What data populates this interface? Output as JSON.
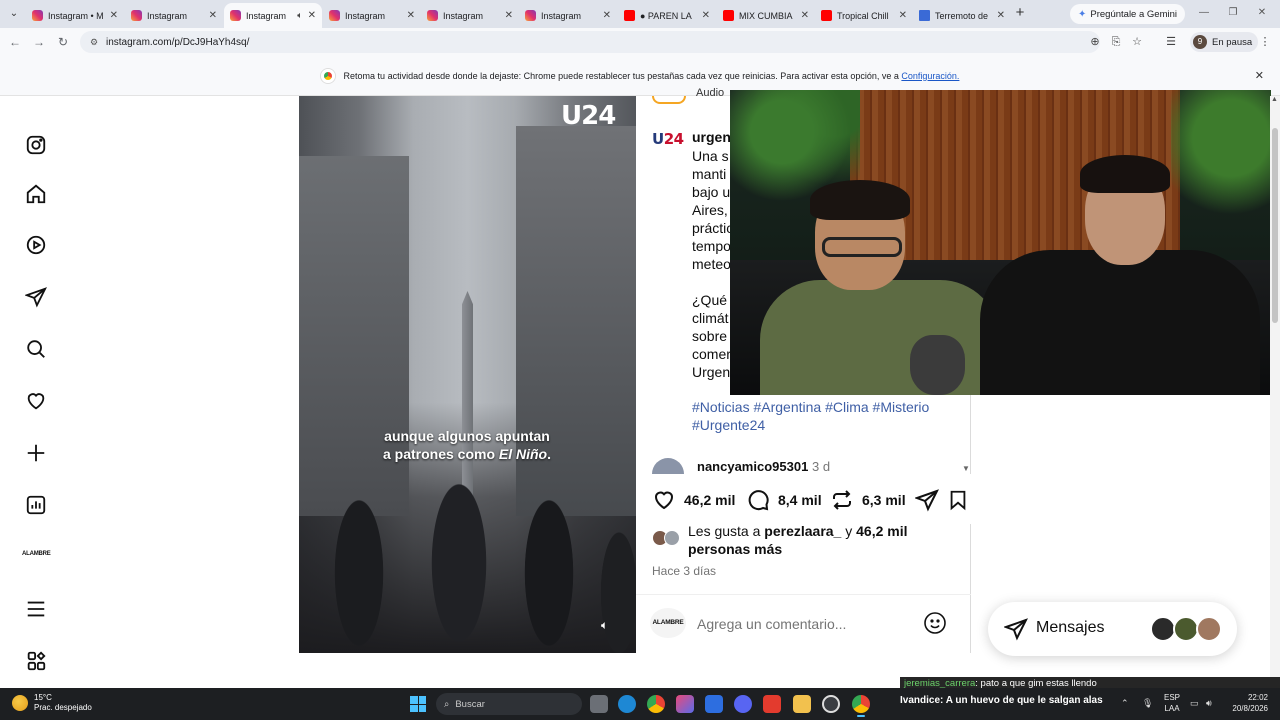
{
  "browser": {
    "tabs": [
      {
        "title": "Instagram • M",
        "favicon": "instagram-icon",
        "active": false
      },
      {
        "title": "Instagram",
        "favicon": "instagram-icon",
        "active": false
      },
      {
        "title": "Instagram",
        "favicon": "instagram-icon",
        "active": true,
        "sound": true
      },
      {
        "title": "Instagram",
        "favicon": "instagram-icon",
        "active": false
      },
      {
        "title": "Instagram",
        "favicon": "instagram-icon",
        "active": false
      },
      {
        "title": "Instagram",
        "favicon": "instagram-icon",
        "active": false
      },
      {
        "title": "● PAREN LA",
        "favicon": "youtube-icon",
        "active": false
      },
      {
        "title": "MIX CUMBIA",
        "favicon": "youtube-icon",
        "active": false
      },
      {
        "title": "Tropical Chill",
        "favicon": "youtube-icon",
        "active": false
      },
      {
        "title": "Terremoto de",
        "favicon": "web-icon",
        "active": false
      }
    ],
    "gemini_label": "Pregúntale a Gemini",
    "url": "instagram.com/p/DcJ9HaYh4sq/",
    "profile_initial": "9",
    "profile_status": "En pausa"
  },
  "infobar": {
    "text": "Retoma tu actividad desde donde la dejaste: Chrome puede restablecer tus pestañas cada vez que reinicias. Para activar esta opción, ve a",
    "link": "Configuración."
  },
  "sidebar": {
    "icons": [
      "instagram-icon",
      "home-icon",
      "reels-icon",
      "messages-icon",
      "search-icon",
      "notifications-icon",
      "create-icon",
      "dashboard-icon",
      "profile-icon",
      "more-icon",
      "meta-apps-icon"
    ],
    "profile_label": "ALAMBRE"
  },
  "video": {
    "logo": "U24",
    "subtitle_line1": "aunque algunos apuntan",
    "subtitle_line2_prefix": "a patrones como ",
    "subtitle_line2_emph": "El Niño",
    "subtitle_line2_suffix": "."
  },
  "post": {
    "audio_label": "Audio",
    "author_logo_u": "U",
    "author_logo_24": "24",
    "author": "urgen",
    "caption_lines": [
      "Una s",
      "manti",
      "bajo u",
      "Aires,",
      "práctic",
      "tempo",
      "meteo",
      "",
      "¿Qué",
      "climát",
      "sobre",
      "comer",
      "Urgen"
    ],
    "hashtags": "#Noticias #Argentina #Clima #Misterio #Urgente24",
    "comment_user": "nancyamico95301",
    "comment_time": "3 d",
    "likes_count": "46,2 mil",
    "comments_count": "8,4 mil",
    "reposts_count": "6,3 mil",
    "liked_by_prefix": "Les gusta a ",
    "liked_by_user": "perezlaara_",
    "liked_by_middle": " y ",
    "liked_by_count": "46,2 mil",
    "liked_by_suffix": "personas más",
    "posted_ago": "Hace 3 días",
    "comment_placeholder": "Agrega un comentario...",
    "commenter_label": "ALAMBRE"
  },
  "messages": {
    "label": "Mensajes"
  },
  "stream_chat": [
    {
      "user": "jeremias_carrera",
      "text": ": pato a que gim estas llendo"
    },
    {
      "user": "Ivandice",
      "text": ": A un huevo de que le salgan alas"
    }
  ],
  "taskbar": {
    "temperature": "15°C",
    "weather": "Prac. despejado",
    "search_placeholder": "Buscar",
    "lang_line1": "ESP",
    "lang_line2": "LAA",
    "time": "22:02",
    "date": "20/8/2026"
  },
  "colors": {
    "accent_link": "#1a57c7",
    "hashtag": "#3f5fa5",
    "u24_red": "#c8102e",
    "u24_blue": "#243a7a",
    "chat_username": "#6bd16a",
    "taskbar": "#1d1f22"
  }
}
